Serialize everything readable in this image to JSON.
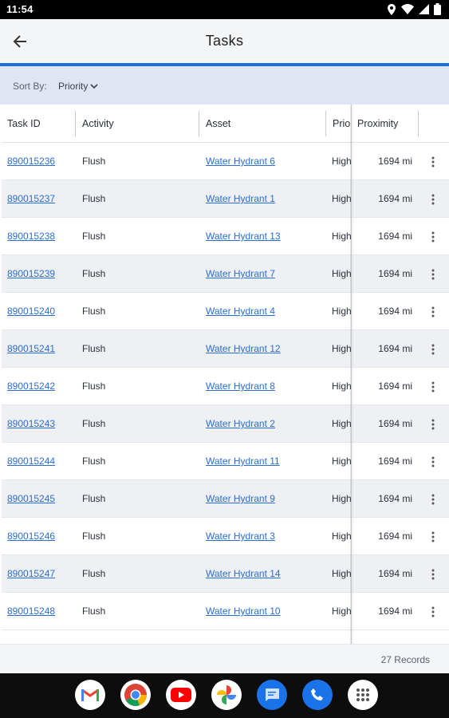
{
  "status_bar": {
    "time": "11:54"
  },
  "app_bar": {
    "title": "Tasks"
  },
  "sort": {
    "label": "Sort By:",
    "value": "Priority"
  },
  "table": {
    "columns": [
      "Task ID",
      "Activity",
      "Asset",
      "Prio",
      "Proximity"
    ],
    "rows": [
      {
        "task_id": "890015236",
        "activity": "Flush",
        "asset": "Water Hydrant 6",
        "priority": "High",
        "proximity": "1694 mi"
      },
      {
        "task_id": "890015237",
        "activity": "Flush",
        "asset": "Water Hydrant 1",
        "priority": "High",
        "proximity": "1694 mi"
      },
      {
        "task_id": "890015238",
        "activity": "Flush",
        "asset": "Water Hydrant 13",
        "priority": "High",
        "proximity": "1694 mi"
      },
      {
        "task_id": "890015239",
        "activity": "Flush",
        "asset": "Water Hydrant 7",
        "priority": "High",
        "proximity": "1694 mi"
      },
      {
        "task_id": "890015240",
        "activity": "Flush",
        "asset": "Water Hydrant 4",
        "priority": "High",
        "proximity": "1694 mi"
      },
      {
        "task_id": "890015241",
        "activity": "Flush",
        "asset": "Water Hydrant 12",
        "priority": "High",
        "proximity": "1694 mi"
      },
      {
        "task_id": "890015242",
        "activity": "Flush",
        "asset": "Water Hydrant 8",
        "priority": "High",
        "proximity": "1694 mi"
      },
      {
        "task_id": "890015243",
        "activity": "Flush",
        "asset": "Water Hydrant 2",
        "priority": "High",
        "proximity": "1694 mi"
      },
      {
        "task_id": "890015244",
        "activity": "Flush",
        "asset": "Water Hydrant 11",
        "priority": "High",
        "proximity": "1694 mi"
      },
      {
        "task_id": "890015245",
        "activity": "Flush",
        "asset": "Water Hydrant 9",
        "priority": "High",
        "proximity": "1694 mi"
      },
      {
        "task_id": "890015246",
        "activity": "Flush",
        "asset": "Water Hydrant 3",
        "priority": "High",
        "proximity": "1694 mi"
      },
      {
        "task_id": "890015247",
        "activity": "Flush",
        "asset": "Water Hydrant 14",
        "priority": "High",
        "proximity": "1694 mi"
      },
      {
        "task_id": "890015248",
        "activity": "Flush",
        "asset": "Water Hydrant 10",
        "priority": "High",
        "proximity": "1694 mi"
      }
    ]
  },
  "footer": {
    "records": "27 Records"
  },
  "dock": {
    "apps": [
      {
        "name": "gmail-icon",
        "color": "#ffffff"
      },
      {
        "name": "chrome-icon",
        "color": "#ffffff"
      },
      {
        "name": "youtube-icon",
        "color": "#ffffff"
      },
      {
        "name": "photos-icon",
        "color": "#ffffff"
      },
      {
        "name": "messages-icon",
        "color": "#1a73e8"
      },
      {
        "name": "phone-icon",
        "color": "#1a73e8"
      },
      {
        "name": "app-drawer-icon",
        "color": "#ffffff"
      }
    ]
  },
  "colors": {
    "accent": "#1e6fd9",
    "link": "#2a6ed6",
    "sort_bar": "#e1e4f2"
  }
}
